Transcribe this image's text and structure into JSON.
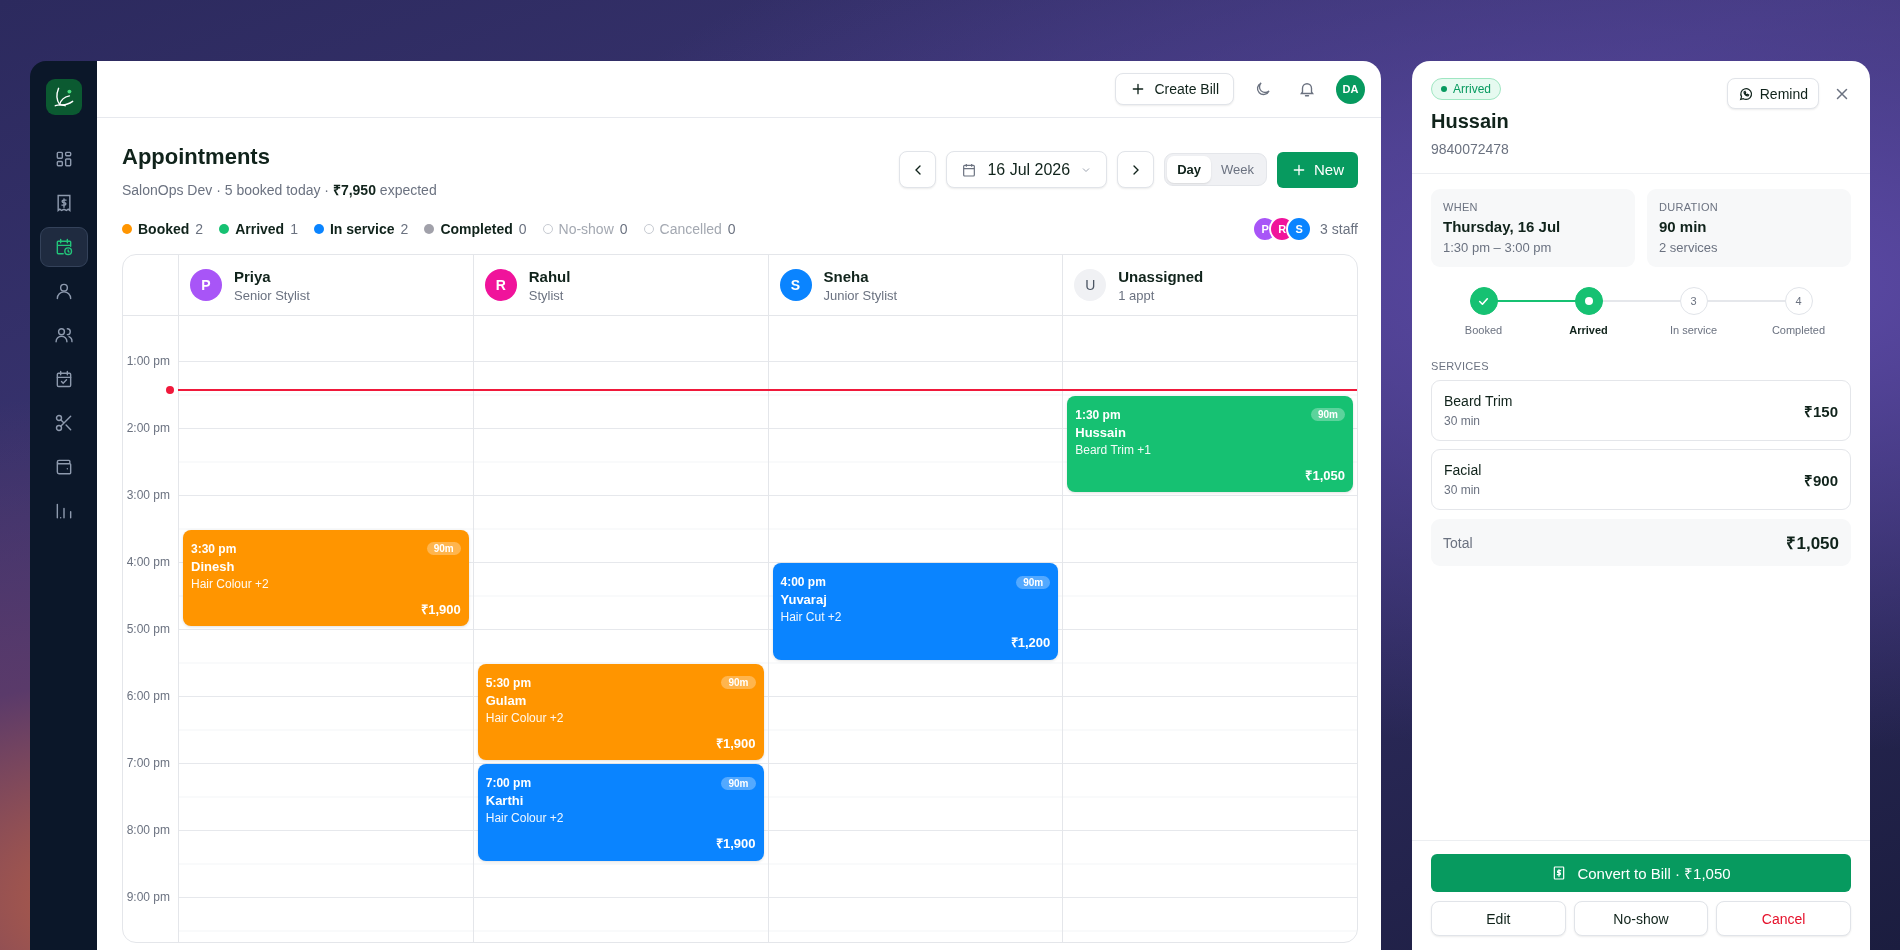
{
  "sidebar": {
    "items": [
      {
        "selected": false
      },
      {
        "selected": false
      },
      {
        "selected": true
      },
      {
        "selected": false
      },
      {
        "selected": false
      },
      {
        "selected": false
      },
      {
        "selected": false
      },
      {
        "selected": false
      },
      {
        "selected": false
      }
    ]
  },
  "header": {
    "create_bill": "Create Bill",
    "avatar": "DA"
  },
  "page": {
    "title": "Appointments",
    "subtitle": "SalonOps Dev · 5 booked today · **₹7,950** expected"
  },
  "toolbar": {
    "date": "16 Jul 2026",
    "views": [
      {
        "label": "Day",
        "selected": true
      },
      {
        "label": "Week",
        "selected": false
      }
    ],
    "new_button": "New"
  },
  "legend": [
    {
      "label": "Booked",
      "count": "2",
      "color": "#ff9500",
      "dimmed": false
    },
    {
      "label": "Arrived",
      "count": "1",
      "color": "#16c172",
      "dimmed": false
    },
    {
      "label": "In service",
      "count": "2",
      "color": "#0a84ff",
      "dimmed": false
    },
    {
      "label": "Completed",
      "count": "0",
      "color": "#a1a1aa",
      "dimmed": false
    },
    {
      "label": "No-show",
      "count": "0",
      "dimmed": true
    },
    {
      "label": "Cancelled",
      "count": "0",
      "dimmed": true
    }
  ],
  "staff_summary": {
    "avatars": [
      {
        "initial": "P",
        "color": "#a855f7"
      },
      {
        "initial": "R",
        "color": "#f0139b"
      },
      {
        "initial": "S",
        "color": "#0a84ff"
      }
    ],
    "label": "3 staff"
  },
  "calendar": {
    "time_labels": [
      "1:00 pm",
      "2:00 pm",
      "3:00 pm",
      "4:00 pm",
      "5:00 pm",
      "6:00 pm",
      "7:00 pm",
      "8:00 pm",
      "9:00 pm"
    ],
    "columns": [
      {
        "kind": "staff",
        "name": "Priya",
        "role": "Senior Stylist",
        "initial": "P",
        "color": "#a855f7",
        "appointments": [
          {
            "time": "3:30 pm",
            "duration": "90m",
            "client": "Dinesh",
            "services": "Hair Colour +2",
            "price": "₹1,900",
            "color": "#ff9500"
          }
        ]
      },
      {
        "kind": "staff",
        "name": "Rahul",
        "role": "Stylist",
        "initial": "R",
        "color": "#f0139b",
        "appointments": [
          {
            "time": "5:30 pm",
            "duration": "90m",
            "client": "Gulam",
            "services": "Hair Colour +2",
            "price": "₹1,900",
            "color": "#ff9500"
          },
          {
            "time": "7:00 pm",
            "duration": "90m",
            "client": "Karthi",
            "services": "Hair Colour +2",
            "price": "₹1,900",
            "color": "#0a84ff"
          }
        ]
      },
      {
        "kind": "staff",
        "name": "Sneha",
        "role": "Junior Stylist",
        "initial": "S",
        "color": "#0a84ff",
        "appointments": [
          {
            "time": "4:00 pm",
            "duration": "90m",
            "client": "Yuvaraj",
            "services": "Hair Cut +2",
            "price": "₹1,200",
            "color": "#0a84ff"
          }
        ]
      },
      {
        "kind": "unassigned",
        "name": "Unassigned",
        "role": "1 appt",
        "initial": "U",
        "appointments": [
          {
            "time": "1:30 pm",
            "duration": "90m",
            "client": "Hussain",
            "services": "Beard Trim +1",
            "price": "₹1,050",
            "color": "#16c172"
          }
        ]
      }
    ]
  },
  "details": {
    "status": "Arrived",
    "remind": "Remind",
    "client": "Hussain",
    "phone": "9840072478",
    "info": [
      {
        "label": "WHEN",
        "value": "Thursday, 16 Jul",
        "sub": "1:30 pm – 3:00 pm"
      },
      {
        "label": "DURATION",
        "value": "90 min",
        "sub": "2 services"
      }
    ],
    "steps": [
      {
        "label": "Booked",
        "done": true,
        "current": false
      },
      {
        "label": "Arrived",
        "done": false,
        "current": true
      },
      {
        "label": "In service",
        "number": "3",
        "done": false,
        "current": false
      },
      {
        "label": "Completed",
        "number": "4",
        "done": false,
        "current": false
      }
    ],
    "services_heading": "SERVICES",
    "services": [
      {
        "name": "Beard Trim",
        "duration": "30 min",
        "price": "₹150"
      },
      {
        "name": "Facial",
        "duration": "30 min",
        "price": "₹900"
      }
    ],
    "total_label": "Total",
    "total": "₹1,050",
    "convert_button": "Convert to Bill · ₹1,050",
    "edit_button": "Edit",
    "no_show_button": "No-show",
    "cancel_button": "Cancel"
  }
}
